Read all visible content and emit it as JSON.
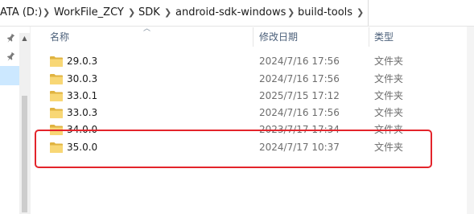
{
  "breadcrumb": {
    "segments": [
      "ATA (D:)",
      "WorkFile_ZCY",
      "SDK",
      "android-sdk-windows",
      "build-tools"
    ]
  },
  "columns": {
    "name": "名称",
    "date": "修改日期",
    "type": "类型"
  },
  "files": [
    {
      "name": "29.0.3",
      "date": "2024/7/16 17:56",
      "type": "文件夹"
    },
    {
      "name": "30.0.3",
      "date": "2024/7/16 17:56",
      "type": "文件夹"
    },
    {
      "name": "33.0.1",
      "date": "2025/7/15 17:12",
      "type": "文件夹"
    },
    {
      "name": "33.0.3",
      "date": "2024/7/16 17:56",
      "type": "文件夹"
    },
    {
      "name": "34.0.0",
      "date": "2023/7/17 17:34",
      "type": "文件夹"
    },
    {
      "name": "35.0.0",
      "date": "2024/7/17 10:37",
      "type": "文件夹"
    }
  ],
  "icons": {
    "folder": "folder-icon",
    "pin": "pin-icon",
    "sort": "sort-ascending-icon",
    "chevron": "chevron-right-icon"
  },
  "colors": {
    "highlight": "#e3242b",
    "folder": "#f8d775",
    "folder_dark": "#e0b340",
    "header_text": "#4c607a"
  }
}
